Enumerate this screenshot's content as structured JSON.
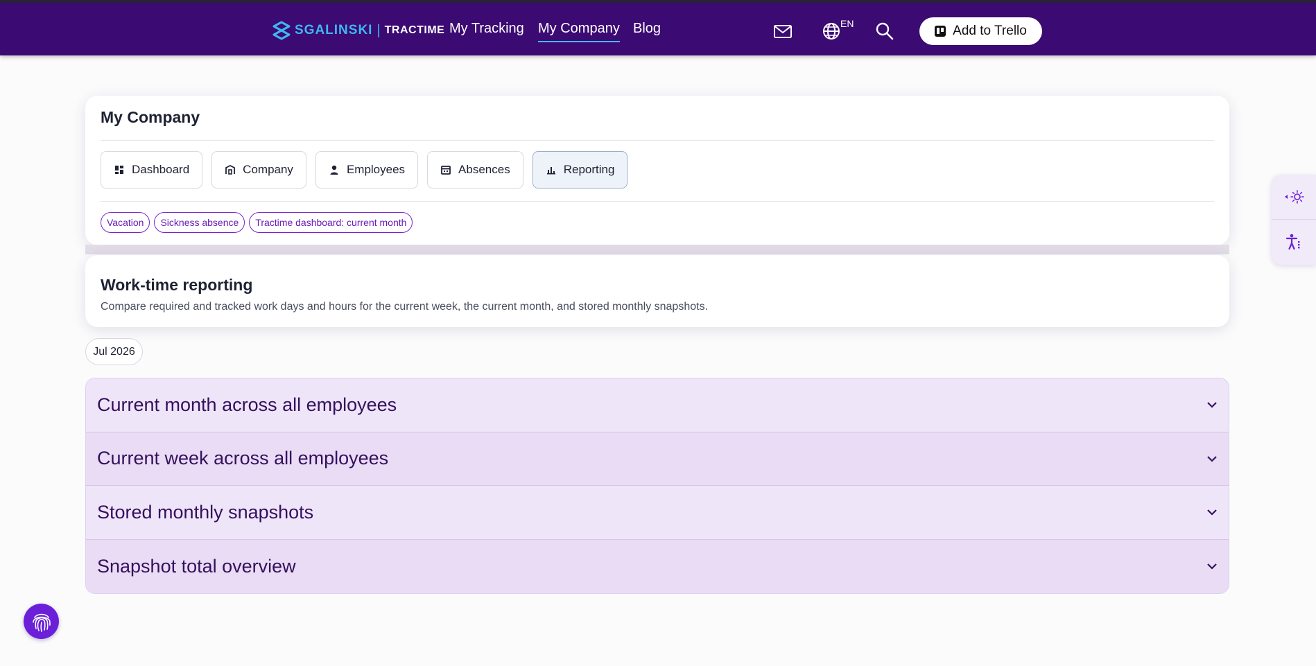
{
  "nav": {
    "brand": "SGALINSKI",
    "separator": "|",
    "product": "TRACTIME",
    "links": [
      "My Tracking",
      "My Company",
      "Blog"
    ],
    "active_link": "My Company",
    "language": "EN",
    "trello_label": "Add to Trello"
  },
  "company": {
    "title": "My Company",
    "tabs": [
      {
        "label": "Dashboard",
        "icon": "dashboard-icon"
      },
      {
        "label": "Company",
        "icon": "building-icon"
      },
      {
        "label": "Employees",
        "icon": "person-icon"
      },
      {
        "label": "Absences",
        "icon": "calendar-icon"
      },
      {
        "label": "Reporting",
        "icon": "bar-chart-icon"
      }
    ],
    "active_tab": "Reporting",
    "chips": [
      "Vacation",
      "Sickness absence",
      "Tractime dashboard: current month"
    ]
  },
  "report": {
    "title": "Work-time reporting",
    "description": "Compare required and tracked work days and hours for the current week, the current month, and stored monthly snapshots."
  },
  "month_filter": "Jul 2026",
  "accordion": [
    "Current month across all employees",
    "Current week across all employees",
    "Stored monthly snapshots",
    "Snapshot total overview"
  ],
  "colors": {
    "navbar": "#3b0a72",
    "brand_blue": "#3fb6f0",
    "accent_purple": "#6b1fd8",
    "accordion_bg": "#efe5f8"
  }
}
